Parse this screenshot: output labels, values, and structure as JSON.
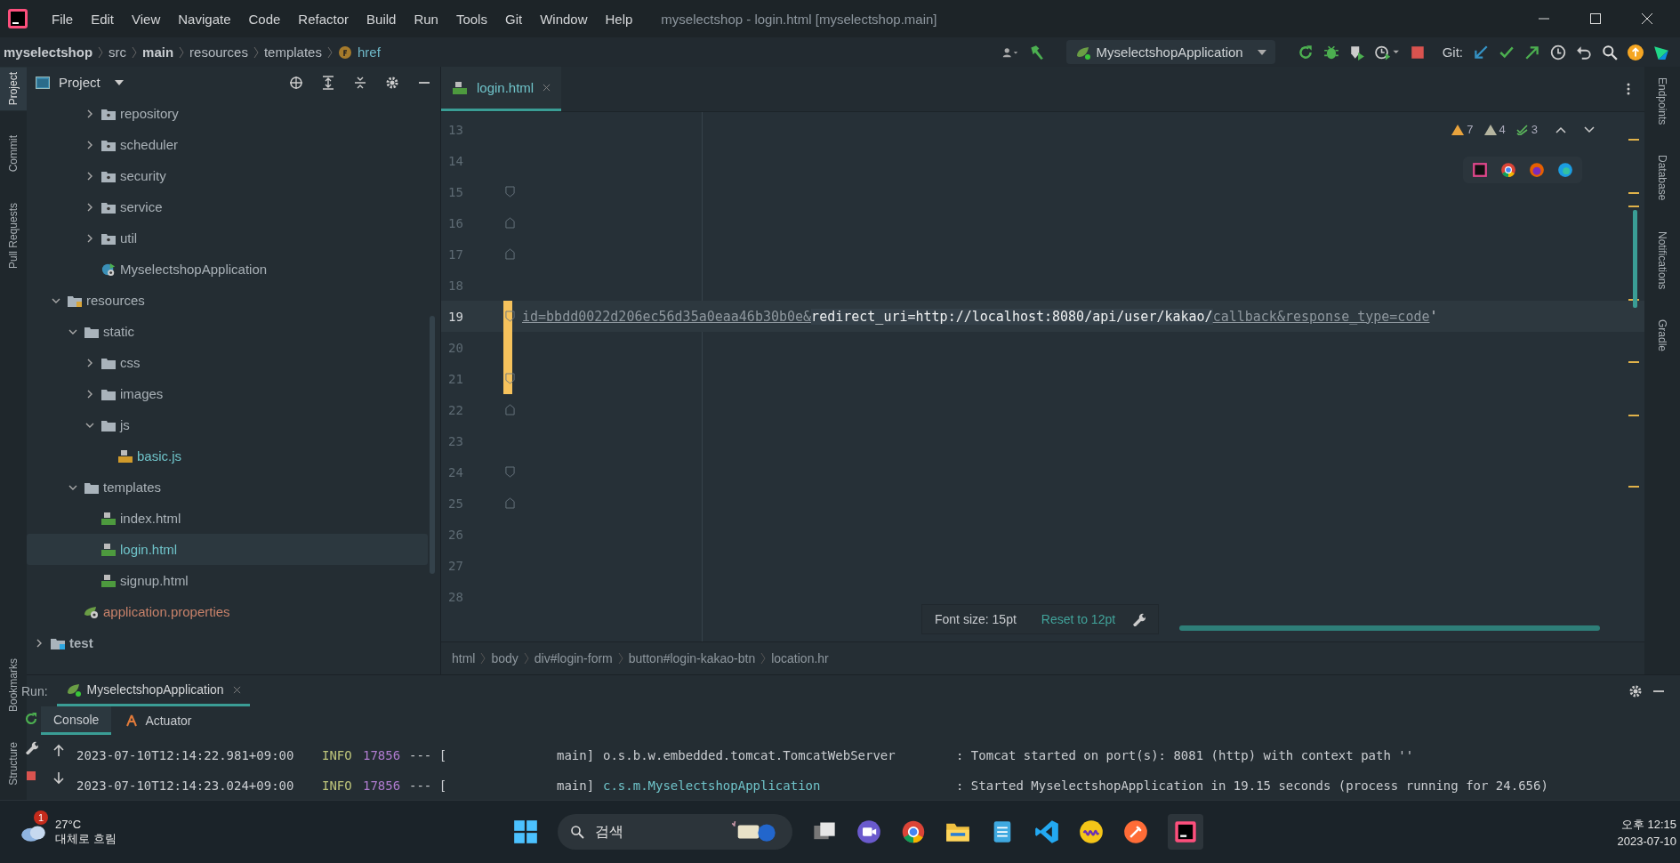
{
  "window": {
    "title": "myselectshop - login.html [myselectshop.main]"
  },
  "menu": [
    "File",
    "Edit",
    "View",
    "Navigate",
    "Code",
    "Refactor",
    "Build",
    "Run",
    "Tools",
    "Git",
    "Window",
    "Help"
  ],
  "nav_path": [
    {
      "label": "myselectshop",
      "bold": true,
      "kind": "folder"
    },
    {
      "label": "src",
      "bold": false,
      "kind": "folder"
    },
    {
      "label": "main",
      "bold": true,
      "kind": "folder"
    },
    {
      "label": "resources",
      "bold": false,
      "kind": "folder"
    },
    {
      "label": "templates",
      "bold": false,
      "kind": "folder"
    },
    {
      "label": "href",
      "bold": false,
      "kind": "field"
    }
  ],
  "toolbar": {
    "run_config": "MyselectshopApplication",
    "git_label": "Git:"
  },
  "left_tools": [
    {
      "label": "Project",
      "selected": true
    },
    {
      "label": "Commit",
      "selected": false
    },
    {
      "label": "Pull Requests",
      "selected": false
    }
  ],
  "left_tools_bottom": [
    {
      "label": "Bookmarks"
    },
    {
      "label": "Structure"
    }
  ],
  "project_panel": {
    "title": "Project",
    "tree": [
      {
        "children": [
          {
            "children": [
              {
                "children": [
                  {
                    "label": "repository",
                    "kind": "package",
                    "expanded": false,
                    "selected": false,
                    "modified": false,
                    "unversioned": false
                  },
                  {
                    "label": "scheduler",
                    "kind": "package",
                    "expanded": false,
                    "selected": false,
                    "modified": false,
                    "unversioned": false
                  },
                  {
                    "label": "security",
                    "kind": "package",
                    "expanded": false,
                    "selected": false,
                    "modified": false,
                    "unversioned": false
                  },
                  {
                    "label": "service",
                    "kind": "package",
                    "expanded": false,
                    "selected": false,
                    "modified": false,
                    "unversioned": false
                  },
                  {
                    "label": "util",
                    "kind": "package",
                    "expanded": false,
                    "selected": false,
                    "modified": false,
                    "unversioned": false
                  },
                  {
                    "label": "MyselectshopApplication",
                    "kind": "spring-class",
                    "selected": false,
                    "modified": false,
                    "unversioned": false
                  }
                ]
              }
            ]
          },
          {
            "label": "resources",
            "kind": "resources",
            "expanded": true,
            "selected": false,
            "modified": false,
            "unversioned": false,
            "children": [
              {
                "label": "static",
                "kind": "folder",
                "expanded": true,
                "selected": false,
                "modified": false,
                "unversioned": false,
                "children": [
                  {
                    "label": "css",
                    "kind": "folder",
                    "expanded": false,
                    "selected": false,
                    "modified": false,
                    "unversioned": false
                  },
                  {
                    "label": "images",
                    "kind": "folder",
                    "expanded": false,
                    "selected": false,
                    "modified": false,
                    "unversioned": false
                  },
                  {
                    "label": "js",
                    "kind": "folder",
                    "expanded": true,
                    "selected": false,
                    "modified": false,
                    "unversioned": false,
                    "children": [
                      {
                        "label": "basic.js",
                        "kind": "js",
                        "selected": false,
                        "modified": true,
                        "unversioned": false
                      }
                    ]
                  }
                ]
              },
              {
                "label": "templates",
                "kind": "folder",
                "expanded": true,
                "selected": false,
                "modified": false,
                "unversioned": false,
                "children": [
                  {
                    "label": "index.html",
                    "kind": "html",
                    "selected": false,
                    "modified": false,
                    "unversioned": false
                  },
                  {
                    "label": "login.html",
                    "kind": "html",
                    "selected": true,
                    "modified": true,
                    "unversioned": false
                  },
                  {
                    "label": "signup.html",
                    "kind": "html",
                    "selected": false,
                    "modified": false,
                    "unversioned": false
                  }
                ]
              },
              {
                "label": "application.properties",
                "kind": "properties",
                "selected": false,
                "modified": false,
                "unversioned": true
              }
            ]
          }
        ]
      },
      {
        "label": "test",
        "kind": "test",
        "expanded": false,
        "selected": false,
        "modified": false,
        "unversioned": false,
        "bold": true
      }
    ]
  },
  "editor": {
    "tabs": [
      {
        "label": "login.html",
        "selected": true
      }
    ],
    "inspections": [
      {
        "kind": "warning",
        "count": "7"
      },
      {
        "kind": "weak",
        "count": "4"
      },
      {
        "kind": "typo",
        "count": "3"
      }
    ],
    "lines": [
      {
        "number": "13",
        "fold_start": false,
        "fold_end": false,
        "changed": false,
        "current": false
      },
      {
        "number": "14",
        "fold_start": false,
        "fold_end": false,
        "changed": false,
        "current": false
      },
      {
        "number": "15",
        "fold_start": true,
        "fold_end": false,
        "changed": false,
        "current": false
      },
      {
        "number": "16",
        "fold_start": false,
        "fold_end": true,
        "changed": false,
        "current": false
      },
      {
        "number": "17",
        "fold_start": false,
        "fold_end": true,
        "changed": false,
        "current": false
      },
      {
        "number": "18",
        "fold_start": false,
        "fold_end": false,
        "changed": false,
        "current": false
      },
      {
        "number": "19",
        "fold_start": true,
        "fold_end": false,
        "changed": true,
        "current": true,
        "segments": [
          {
            "text": "id=bbdd0022d206ec56d35a0eaa46b30b0e&",
            "kind": "url",
            "selected": false
          },
          {
            "text": "redirect_uri=http://localhost:8080/api/user/kakao/",
            "kind": "url",
            "selected": true
          },
          {
            "text": "callback&response_type=code",
            "kind": "url",
            "selected": false
          },
          {
            "text": "'",
            "kind": "plain",
            "selected": false
          }
        ]
      },
      {
        "number": "20",
        "fold_start": false,
        "fold_end": false,
        "changed": true,
        "current": false
      },
      {
        "number": "21",
        "fold_start": true,
        "fold_end": false,
        "changed": true,
        "current": false
      },
      {
        "number": "22",
        "fold_start": false,
        "fold_end": true,
        "changed": false,
        "current": false
      },
      {
        "number": "23",
        "fold_start": false,
        "fold_end": false,
        "changed": false,
        "current": false
      },
      {
        "number": "24",
        "fold_start": true,
        "fold_end": false,
        "changed": false,
        "current": false
      },
      {
        "number": "25",
        "fold_start": false,
        "fold_end": true,
        "changed": false,
        "current": false
      },
      {
        "number": "26",
        "fold_start": false,
        "fold_end": false,
        "changed": false,
        "current": false
      },
      {
        "number": "27",
        "fold_start": false,
        "fold_end": false,
        "changed": false,
        "current": false
      },
      {
        "number": "28",
        "fold_start": false,
        "fold_end": false,
        "changed": false,
        "current": false
      }
    ],
    "breadcrumb": [
      "html",
      "body",
      "div#login-form",
      "button#login-kakao-btn",
      "location.hr"
    ],
    "font_popup": {
      "text": "Font size: 15pt",
      "action": "Reset to 12pt"
    }
  },
  "right_tools": [
    "Endpoints",
    "Database",
    "Notifications",
    "Gradle"
  ],
  "run_panel": {
    "label": "Run:",
    "tabs": [
      {
        "label": "MyselectshopApplication",
        "selected": true
      }
    ],
    "subtabs": [
      {
        "label": "Console",
        "selected": true
      },
      {
        "label": "Actuator",
        "selected": false
      }
    ],
    "log": [
      {
        "time": "2023-07-10T12:14:22.981+09:00",
        "level": "INFO",
        "pid": "17856",
        "sep": "--- [",
        "thread": "main]",
        "logger": "o.s.b.w.embedded.tomcat.TomcatWebServer",
        "link": false,
        "message": ": Tomcat started on port(s): 8081 (http) with context path ''"
      },
      {
        "time": "2023-07-10T12:14:23.024+09:00",
        "level": "INFO",
        "pid": "17856",
        "sep": "--- [",
        "thread": "main]",
        "logger": "c.s.m.MyselectshopApplication",
        "link": true,
        "message": ": Started MyselectshopApplication in 19.15 seconds (process running for 24.656)"
      }
    ]
  },
  "taskbar": {
    "weather": {
      "badge": "1",
      "temp": "27°C",
      "desc": "대체로 흐림"
    },
    "search": {
      "placeholder": "검색"
    },
    "clock": {
      "time": "오후 12:15",
      "date": "2023-07-10"
    }
  }
}
